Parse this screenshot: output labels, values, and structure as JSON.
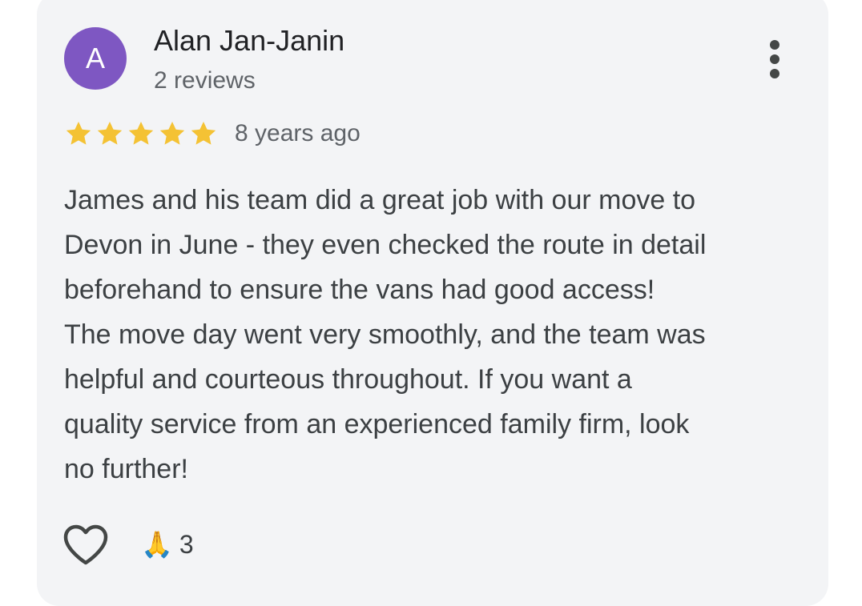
{
  "review": {
    "avatar_initial": "A",
    "author": "Alan Jan-Janin",
    "author_meta": "2 reviews",
    "rating": 5,
    "rating_max": 5,
    "time": "8 years ago",
    "text_lines": [
      "James and his team did a great job with our move to",
      "Devon in June - they even checked the route in detail",
      "beforehand to ensure the vans had good access!",
      "The move day went very smoothly, and the team was",
      "helpful and courteous throughout. If you want a",
      "quality service from an experienced family firm, look",
      "no further!"
    ],
    "reaction_emoji": "🙏",
    "reaction_count": "3"
  },
  "colors": {
    "card_background": "#f3f4f6",
    "avatar": "#7e57c2",
    "star": "#f4c234",
    "text": "#3c4043"
  },
  "icons": {
    "more": "more-vertical-icon",
    "like": "heart-outline-icon",
    "star": "star-icon"
  }
}
